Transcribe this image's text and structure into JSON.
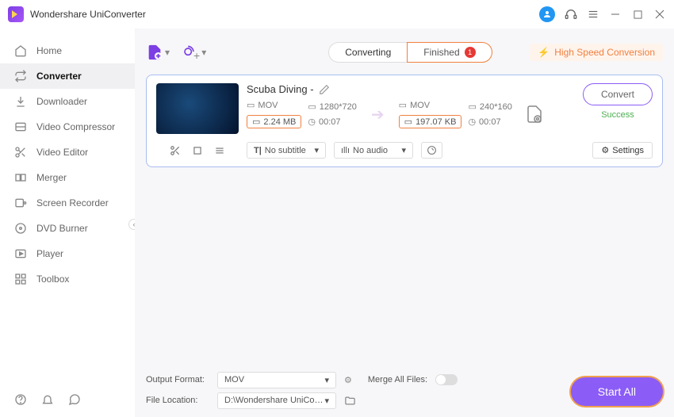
{
  "app": {
    "title": "Wondershare UniConverter"
  },
  "sidebar": {
    "items": [
      {
        "label": "Home"
      },
      {
        "label": "Converter"
      },
      {
        "label": "Downloader"
      },
      {
        "label": "Video Compressor"
      },
      {
        "label": "Video Editor"
      },
      {
        "label": "Merger"
      },
      {
        "label": "Screen Recorder"
      },
      {
        "label": "DVD Burner"
      },
      {
        "label": "Player"
      },
      {
        "label": "Toolbox"
      }
    ]
  },
  "tabs": {
    "converting": "Converting",
    "finished": "Finished",
    "finished_count": "1"
  },
  "highspeed": "High Speed Conversion",
  "file": {
    "name": "Scuba Diving -",
    "src": {
      "format": "MOV",
      "resolution": "1280*720",
      "size": "2.24 MB",
      "duration": "00:07"
    },
    "dst": {
      "format": "MOV",
      "resolution": "240*160",
      "size": "197.07 KB",
      "duration": "00:07"
    },
    "subtitle": "No subtitle",
    "audio": "No audio",
    "settings": "Settings",
    "convert": "Convert",
    "status": "Success"
  },
  "bottom": {
    "output_format_label": "Output Format:",
    "output_format": "MOV",
    "merge_label": "Merge All Files:",
    "file_location_label": "File Location:",
    "file_location": "D:\\Wondershare UniConverter",
    "start_all": "Start All"
  }
}
